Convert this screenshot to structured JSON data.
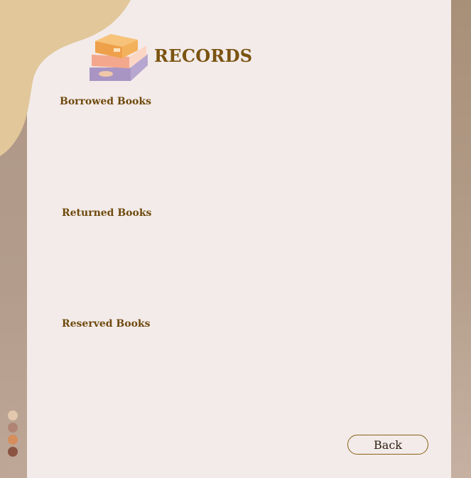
{
  "header": {
    "title": "RECORDS",
    "logo_icon": "stacked-books-icon"
  },
  "sections": [
    {
      "label": "Borrowed Books"
    },
    {
      "label": "Returned Books"
    },
    {
      "label": "Reserved Books"
    }
  ],
  "footer": {
    "back_label": "Back"
  },
  "palette": {
    "background": "#f3ebe9",
    "accent_text": "#7a5310",
    "corner_blob": "#e1c79a",
    "swatches": [
      "#e4c8ae",
      "#b08575",
      "#d58e5c",
      "#8b5442"
    ]
  }
}
